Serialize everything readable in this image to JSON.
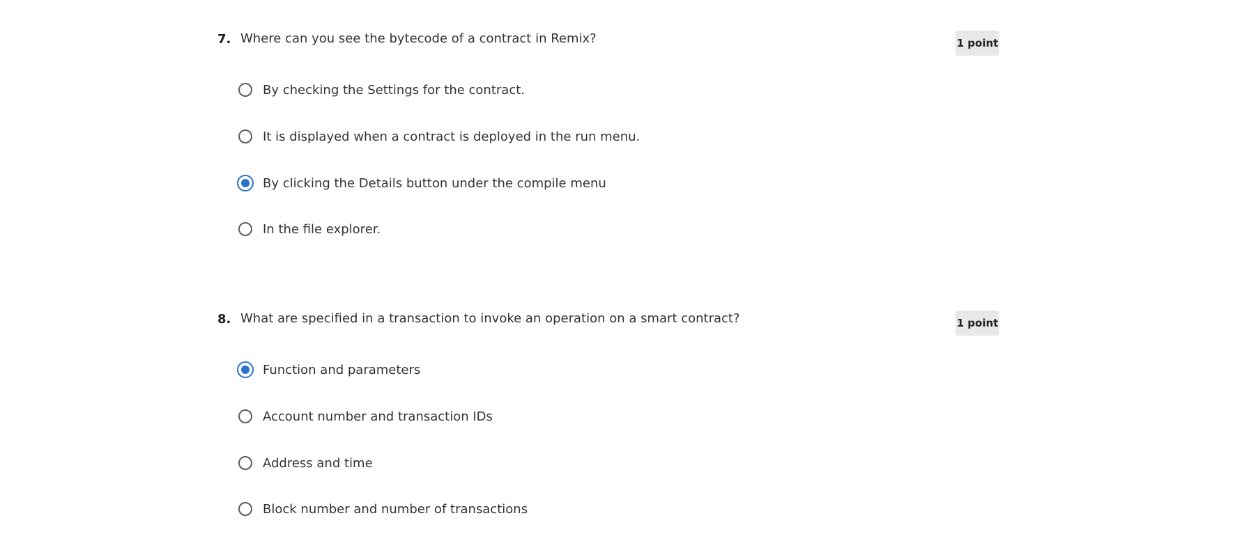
{
  "questions": [
    {
      "number": "7.",
      "prompt": "Where can you see the bytecode of a contract in Remix?",
      "points": "1 point",
      "options": [
        {
          "label": "By checking the Settings for the contract.",
          "selected": false
        },
        {
          "label": "It is displayed when a contract is deployed in the run menu.",
          "selected": false
        },
        {
          "label": "By clicking the Details button under the compile menu",
          "selected": true
        },
        {
          "label": "In the file explorer.",
          "selected": false
        }
      ]
    },
    {
      "number": "8.",
      "prompt": "What are specified in a transaction to invoke an operation on a smart contract?",
      "points": "1 point",
      "options": [
        {
          "label": "Function and parameters",
          "selected": true
        },
        {
          "label": "Account number and transaction IDs",
          "selected": false
        },
        {
          "label": "Address and time",
          "selected": false
        },
        {
          "label": "Block number and number of transactions",
          "selected": false
        }
      ]
    }
  ],
  "colors": {
    "accent": "#2a73cc",
    "badge_bg": "#e8e8e8",
    "text": "#333333"
  }
}
